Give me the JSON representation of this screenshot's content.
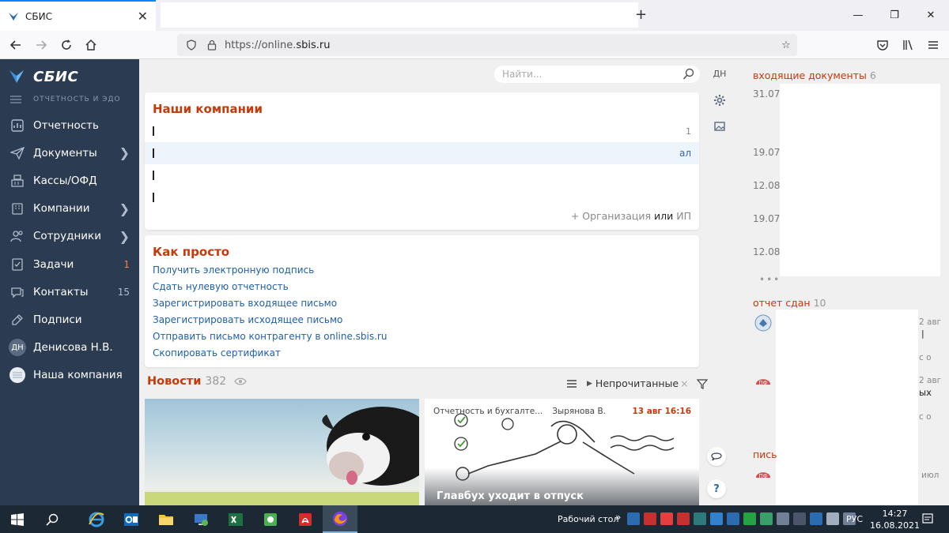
{
  "browser": {
    "tab_title": "СБИС",
    "url_prefix": "https://online.",
    "url_domain": "sbis.ru"
  },
  "sidebar": {
    "brand": "СБИС",
    "subtitle": "ОТЧЕТНОСТЬ И ЭДО",
    "items": [
      {
        "label": "Отчетность",
        "icon": "chart-icon",
        "chevron": false,
        "count": ""
      },
      {
        "label": "Документы",
        "icon": "paper-plane-icon",
        "chevron": true,
        "count": ""
      },
      {
        "label": "Кассы/ОФД",
        "icon": "cash-register-icon",
        "chevron": false,
        "count": ""
      },
      {
        "label": "Компании",
        "icon": "company-icon",
        "chevron": true,
        "count": ""
      },
      {
        "label": "Сотрудники",
        "icon": "employees-icon",
        "chevron": true,
        "count": ""
      },
      {
        "label": "Задачи",
        "icon": "tasks-icon",
        "chevron": false,
        "count": "1"
      },
      {
        "label": "Контакты",
        "icon": "chat-icon",
        "chevron": false,
        "count": "15"
      },
      {
        "label": "Подписи",
        "icon": "signature-icon",
        "chevron": false,
        "count": ""
      }
    ],
    "user": {
      "initials": "ДН",
      "name": "Денисова Н.В."
    },
    "company": "Наша компания"
  },
  "main": {
    "search_placeholder": "Найти...",
    "initials": "ДН",
    "companies": {
      "title": "Наши компании",
      "row1_right": "1",
      "row2_right": "ал",
      "add_org": "+ Организация",
      "or": "или",
      "ip": "ИП"
    },
    "howto": {
      "title": "Как просто",
      "links": [
        "Получить электронную подпись",
        "Сдать нулевую отчетность",
        "Зарегистрировать входящее письмо",
        "Зарегистрировать исходящее письмо",
        "Отправить письмо контрагенту в online.sbis.ru",
        "Скопировать сертификат"
      ]
    },
    "news": {
      "title": "Новости",
      "count": "382",
      "filter": "Непрочитанные",
      "card2": {
        "category": "Отчетность и бухгалте...",
        "author": "Зырянова В.",
        "date": "13 авг 16:16",
        "caption": "Главбух уходит в отпуск"
      }
    }
  },
  "right_panel": {
    "incoming": {
      "title": "входящие документы",
      "count": "6",
      "dates": [
        "31.07",
        "19.07",
        "12.08",
        "19.07",
        "12.08"
      ]
    },
    "report": {
      "title": "отчет сдан",
      "count": "10",
      "items": [
        "2 авг",
        "с о",
        "2 авг",
        "ых",
        "с о"
      ]
    },
    "letters": {
      "title": "пись",
      "item": "июл"
    }
  },
  "taskbar": {
    "tray_label": "Рабочий стол",
    "lang": "РУС",
    "time": "14:27",
    "date": "16.08.2021"
  },
  "colors": {
    "sidebar": "#2b3b51",
    "accent": "#c6390b",
    "link": "#1f5fa8"
  }
}
